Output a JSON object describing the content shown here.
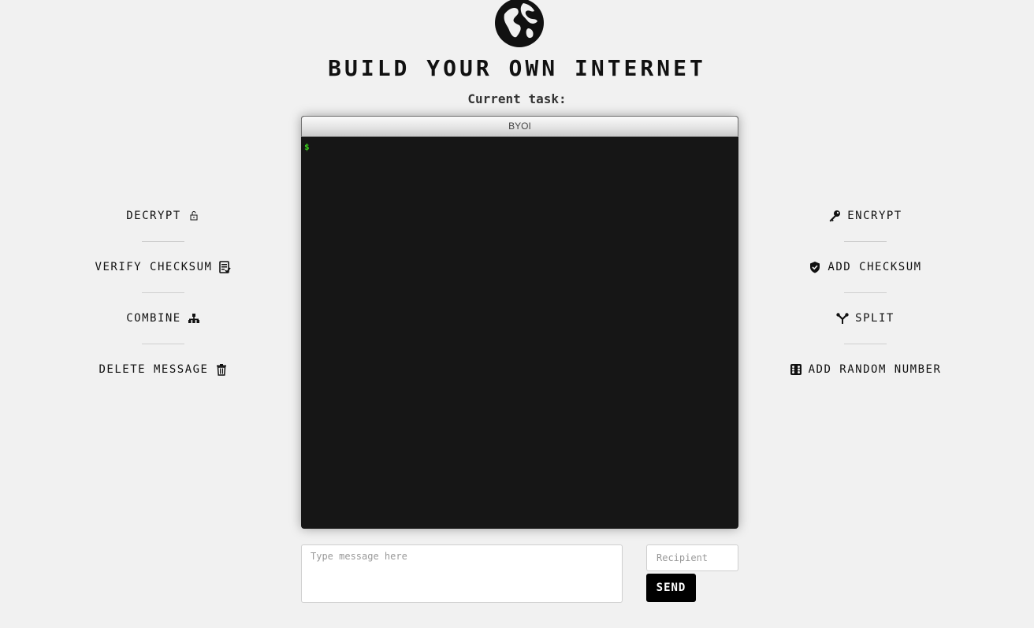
{
  "header": {
    "title": "BUILD YOUR OWN INTERNET",
    "task_label": "Current task:"
  },
  "terminal": {
    "window_title": "BYOI",
    "prompt": "$"
  },
  "left_actions": [
    {
      "label": "DECRYPT",
      "icon": "unlock-icon"
    },
    {
      "label": "VERIFY CHECKSUM",
      "icon": "document-check-icon"
    },
    {
      "label": "COMBINE",
      "icon": "merge-icon"
    },
    {
      "label": "DELETE MESSAGE",
      "icon": "trash-icon"
    }
  ],
  "right_actions": [
    {
      "label": "ENCRYPT",
      "icon": "key-icon"
    },
    {
      "label": "ADD CHECKSUM",
      "icon": "shield-check-icon"
    },
    {
      "label": "SPLIT",
      "icon": "split-icon"
    },
    {
      "label": "ADD RANDOM NUMBER",
      "icon": "dice-icon"
    }
  ],
  "composer": {
    "message_placeholder": "Type message here",
    "recipient_placeholder": "Recipient",
    "send_label": "SEND"
  },
  "colors": {
    "background": "#f1f1f1",
    "terminal_bg": "#161616",
    "prompt": "#3cd21e",
    "send_button": "#000000"
  }
}
